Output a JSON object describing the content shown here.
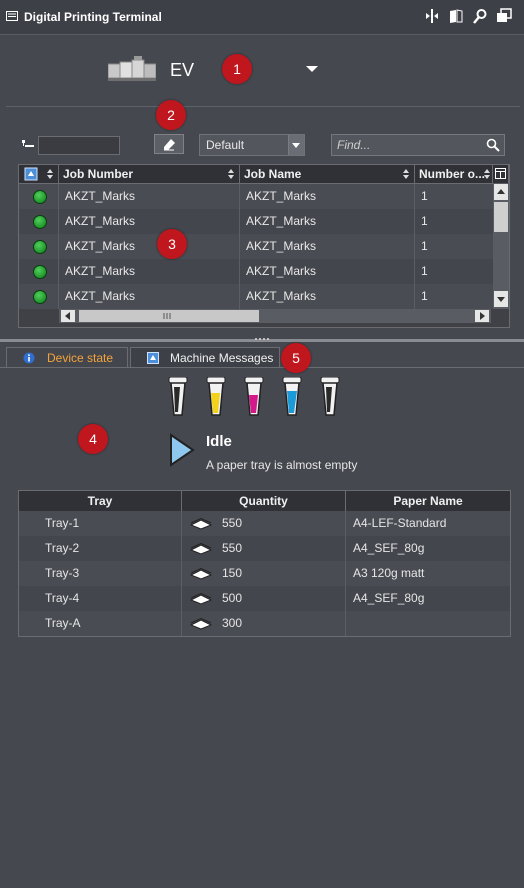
{
  "app": {
    "title": "Digital Printing Terminal"
  },
  "printer": {
    "name": "EV"
  },
  "badges": [
    "1",
    "2",
    "3",
    "4",
    "5"
  ],
  "filter": {
    "selected": "Default",
    "search_placeholder": "Find..."
  },
  "jobs": {
    "columns": [
      "Job Number",
      "Job Name",
      "Number o..."
    ],
    "rows": [
      {
        "job_number": "AKZT_Marks",
        "job_name": "AKZT_Marks",
        "number": "1",
        "status_color": "#1ea12c"
      },
      {
        "job_number": "AKZT_Marks",
        "job_name": "AKZT_Marks",
        "number": "1",
        "status_color": "#1ea12c"
      },
      {
        "job_number": "AKZT_Marks",
        "job_name": "AKZT_Marks",
        "number": "1",
        "status_color": "#1ea12c"
      },
      {
        "job_number": "AKZT_Marks",
        "job_name": "AKZT_Marks",
        "number": "1",
        "status_color": "#1ea12c"
      },
      {
        "job_number": "AKZT_Marks",
        "job_name": "AKZT_Marks",
        "number": "1",
        "status_color": "#1ea12c"
      }
    ]
  },
  "tabs": {
    "device_state": "Device state",
    "machine_messages": "Machine Messages"
  },
  "device": {
    "state": "Idle",
    "message": "A paper tray is almost empty",
    "toner_colors": [
      "#2a2a2a",
      "#f2d21a",
      "#d2188a",
      "#1c9ad8",
      "#2a2a2a"
    ]
  },
  "trays": {
    "columns": [
      "Tray",
      "Quantity",
      "Paper Name"
    ],
    "rows": [
      {
        "tray": "Tray-1",
        "quantity": "550",
        "paper": "A4-LEF-Standard"
      },
      {
        "tray": "Tray-2",
        "quantity": "550",
        "paper": "A4_SEF_80g"
      },
      {
        "tray": "Tray-3",
        "quantity": "150",
        "paper": "A3 120g matt"
      },
      {
        "tray": "Tray-4",
        "quantity": "500",
        "paper": "A4_SEF_80g"
      },
      {
        "tray": "Tray-A",
        "quantity": "300",
        "paper": ""
      }
    ]
  },
  "accent": {
    "badge": "#c0161d",
    "active_tab": "#f4a43a"
  }
}
